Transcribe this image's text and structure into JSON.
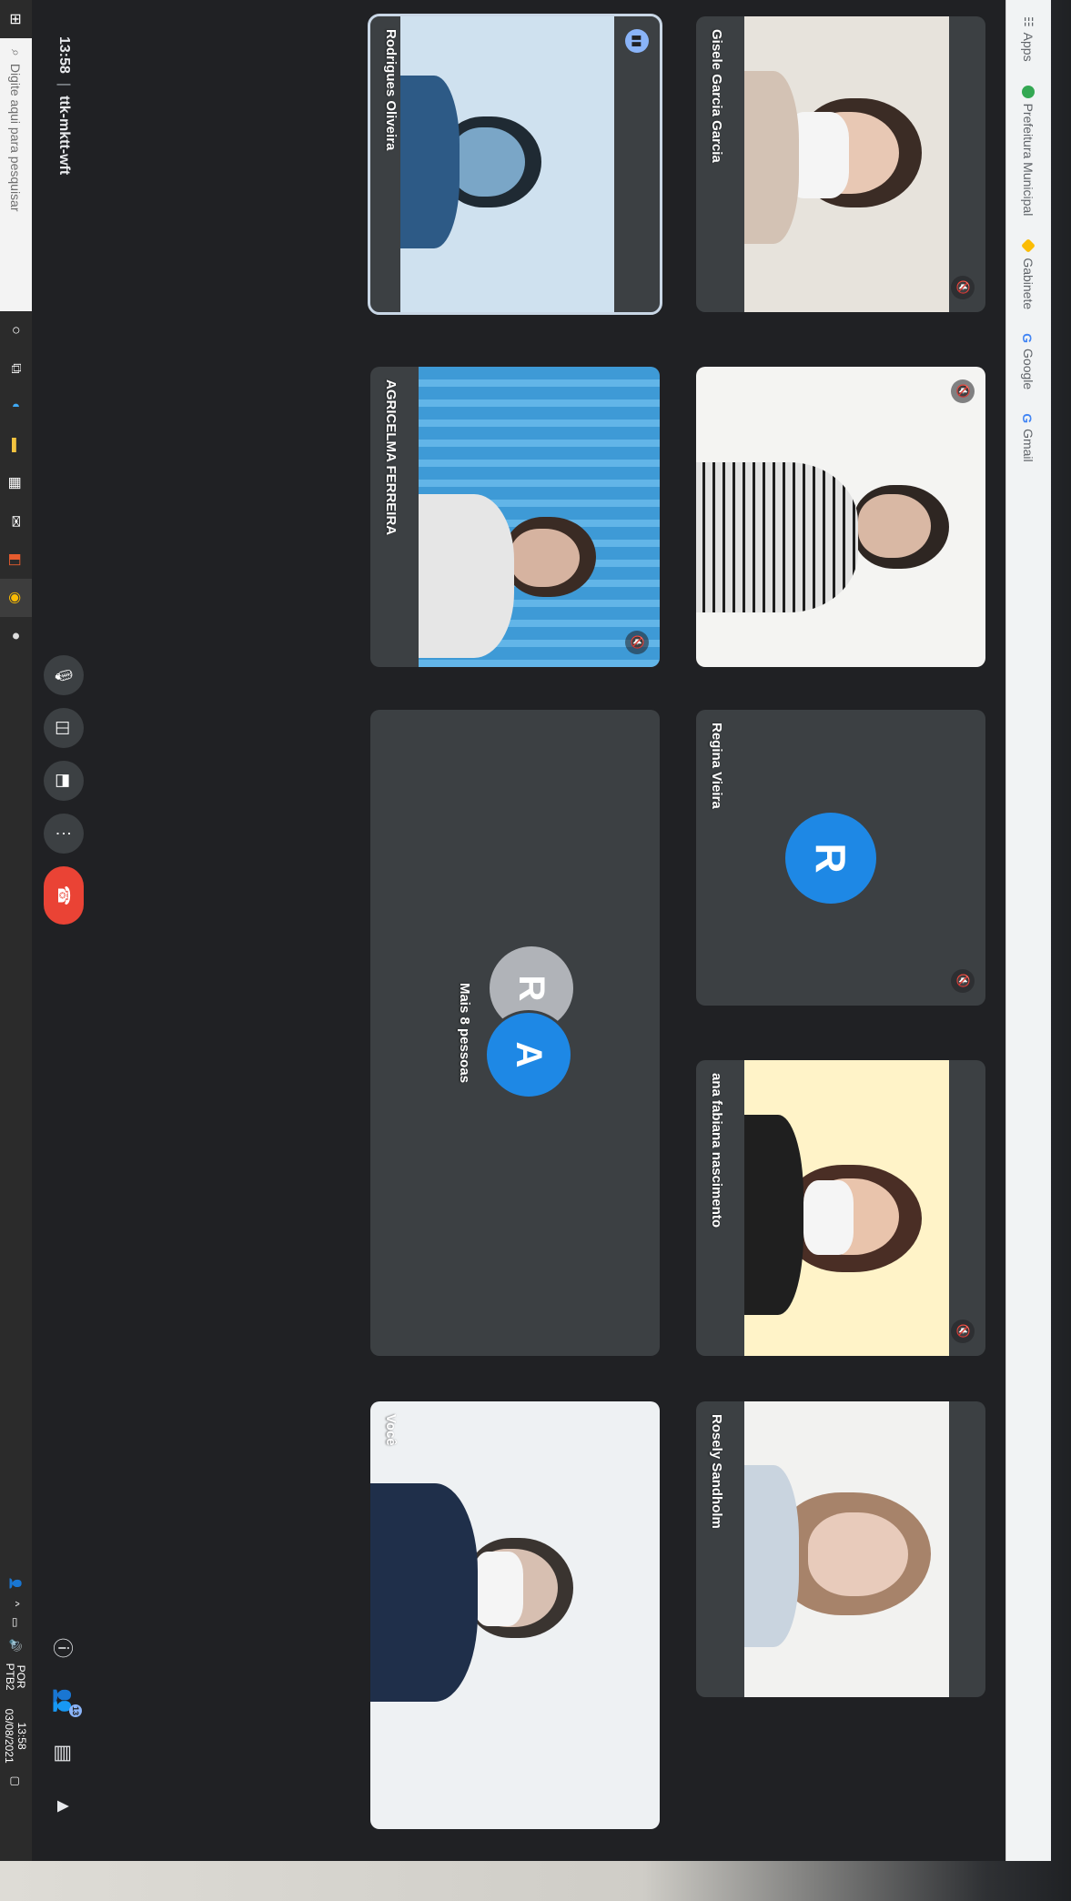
{
  "browser": {
    "bookmarks": [
      {
        "label": "Apps",
        "icon": "apps-grid-icon"
      },
      {
        "label": "Prefeitura Municipal",
        "icon": "prefeitura-icon"
      },
      {
        "label": "Gabinete",
        "icon": "diamond-icon"
      },
      {
        "label": "Google",
        "icon": "google-icon"
      },
      {
        "label": "Gmail",
        "icon": "google-icon"
      }
    ]
  },
  "meet": {
    "time": "13:58",
    "separator": "|",
    "meeting_code": "ttk-mktt-wft",
    "participants": [
      {
        "name": "Gisele Garcia Garcia",
        "type": "video",
        "muted": true
      },
      {
        "name": "",
        "type": "video",
        "muted": true
      },
      {
        "name": "Regina Vieira",
        "type": "avatar",
        "initial": "R",
        "muted": true
      },
      {
        "name": "ana fabiana nascimento",
        "type": "video",
        "muted": true
      },
      {
        "name": "Rosely Sandholm",
        "type": "video",
        "muted": false
      },
      {
        "name": "Rodrigues Oliveira",
        "type": "video",
        "muted": false,
        "active": true
      },
      {
        "name": "AGRICELMA FERREIRA",
        "type": "video",
        "muted": true
      },
      {
        "name": "Mais 8 pessoas",
        "type": "group",
        "initials": [
          "R",
          "A"
        ]
      },
      {
        "name": "Você",
        "type": "video",
        "muted": false
      }
    ],
    "controls": [
      {
        "name": "mic-button",
        "icon": "microphone-icon",
        "glyph": "🎙"
      },
      {
        "name": "camera-button",
        "icon": "camera-icon",
        "glyph": "◫"
      },
      {
        "name": "present-button",
        "icon": "present-screen-icon",
        "glyph": "⬒"
      },
      {
        "name": "more-options-button",
        "icon": "more-vert-icon",
        "glyph": "⋮"
      },
      {
        "name": "leave-call-button",
        "icon": "phone-hangup-icon",
        "glyph": "☎"
      }
    ],
    "right_controls": [
      {
        "name": "info-button",
        "icon": "info-icon",
        "glyph": "ⓘ"
      },
      {
        "name": "people-button",
        "icon": "people-icon",
        "glyph": "👥",
        "badge": "13"
      },
      {
        "name": "chat-button",
        "icon": "chat-icon",
        "glyph": "▤"
      },
      {
        "name": "activities-button",
        "icon": "shapes-icon",
        "glyph": "▲"
      }
    ]
  },
  "taskbar": {
    "search_placeholder": "Digite aqui para pesquisar",
    "tray_lang": "POR",
    "tray_layout": "PTB2",
    "time": "13:58",
    "date": "03/08/2021"
  }
}
